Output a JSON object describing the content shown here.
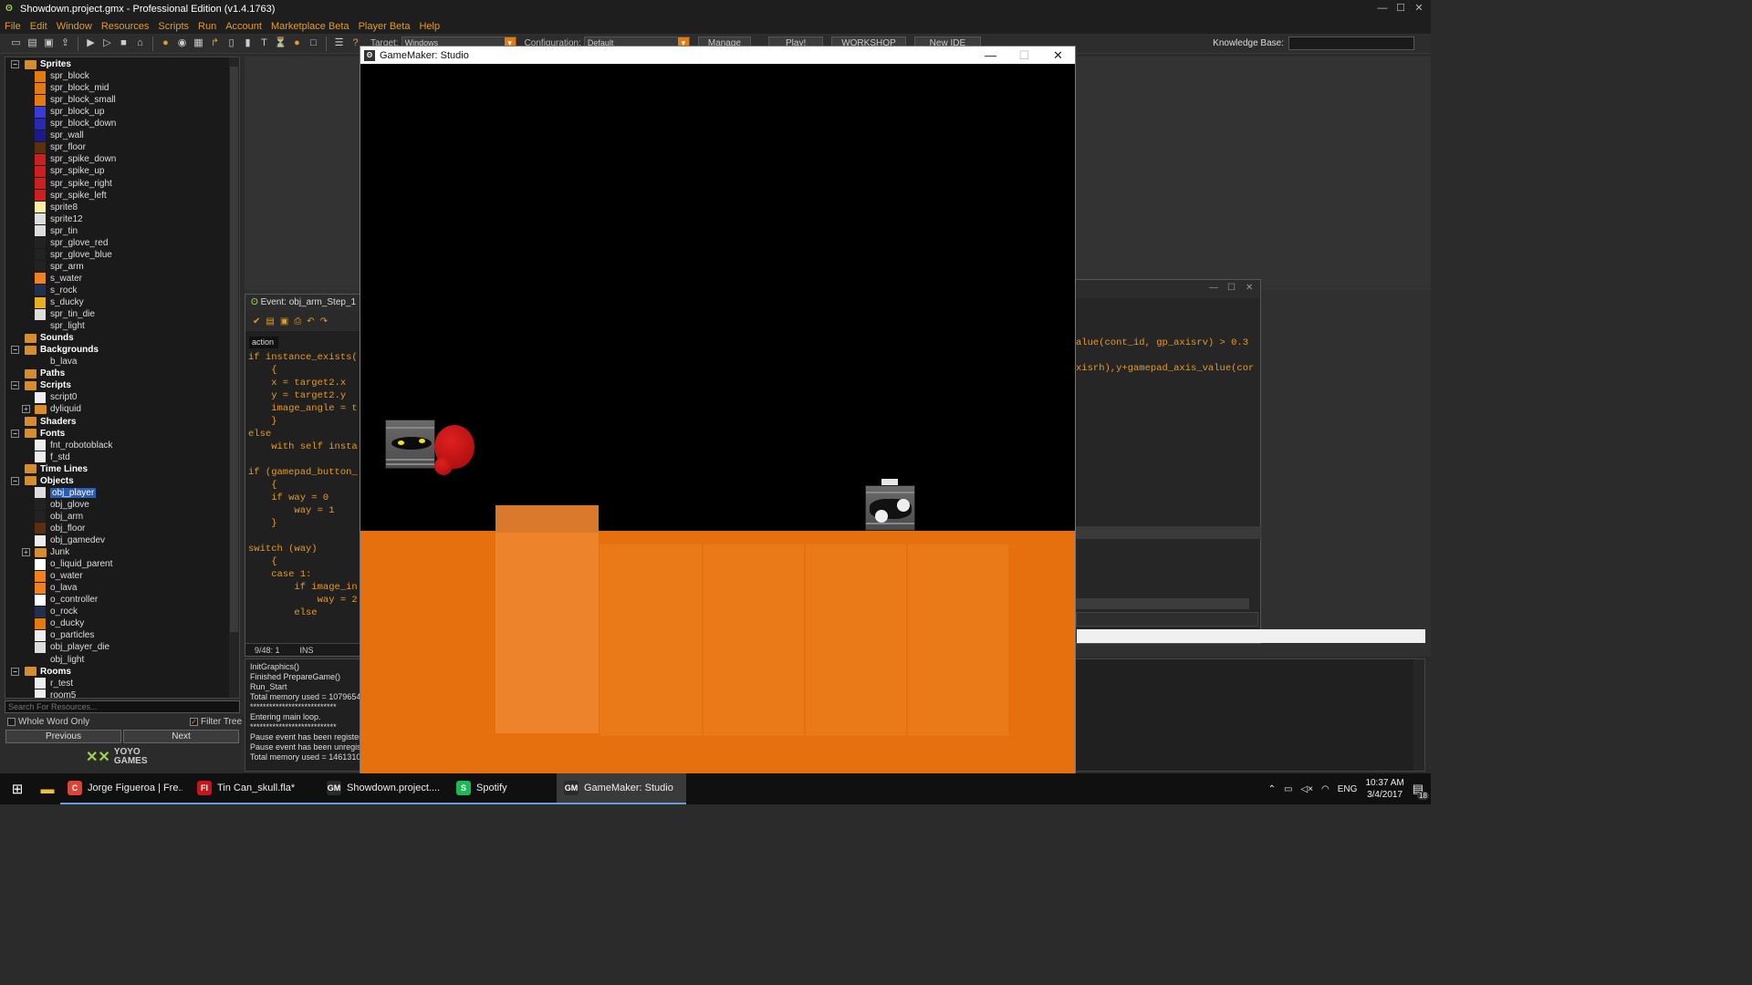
{
  "window": {
    "title": "Showdown.project.gmx  -  Professional Edition (v1.4.1763)"
  },
  "menu": [
    "File",
    "Edit",
    "Window",
    "Resources",
    "Scripts",
    "Run",
    "Account",
    "Marketplace Beta",
    "Player Beta",
    "Help"
  ],
  "toolbar": {
    "target_label": "Target:",
    "target_value": "Windows",
    "config_label": "Configuration:",
    "config_value": "Default",
    "manage": "Manage",
    "play": "Play!",
    "workshop": "WORKSHOP",
    "new_ide": "New IDE",
    "kb_label": "Knowledge Base:"
  },
  "tree": {
    "sprites_label": "Sprites",
    "sprites": [
      "spr_block",
      "spr_block_mid",
      "spr_block_small",
      "spr_block_up",
      "spr_block_down",
      "spr_wall",
      "spr_floor",
      "spr_spike_down",
      "spr_spike_up",
      "spr_spike_right",
      "spr_spike_left",
      "sprite8",
      "sprite12",
      "spr_tin",
      "spr_glove_red",
      "spr_glove_blue",
      "spr_arm",
      "s_water",
      "s_rock",
      "s_ducky",
      "spr_tin_die",
      "spr_light"
    ],
    "sounds": "Sounds",
    "backgrounds": "Backgrounds",
    "bg_items": [
      "b_lava"
    ],
    "paths": "Paths",
    "scripts": "Scripts",
    "script_items": [
      "script0",
      "dyliquid"
    ],
    "shaders": "Shaders",
    "fonts": "Fonts",
    "font_items": [
      "fnt_robotoblack",
      "f_std"
    ],
    "timelines": "Time Lines",
    "objects": "Objects",
    "object_items": [
      "obj_player",
      "obj_glove",
      "obj_arm",
      "obj_floor",
      "obj_gamedev",
      "Junk",
      "o_liquid_parent",
      "o_water",
      "o_lava",
      "o_controller",
      "o_rock",
      "o_ducky",
      "o_particles",
      "obj_player_die",
      "obj_light"
    ],
    "rooms": "Rooms",
    "room_items": [
      "r_test",
      "room5"
    ]
  },
  "search": {
    "placeholder": "Search For Resources...",
    "whole_word": "Whole Word Only",
    "filter_tree": "Filter Tree",
    "previous": "Previous",
    "next": "Next"
  },
  "brand": {
    "logo": "YOYO",
    "sub": "GAMES"
  },
  "event_editor": {
    "title": "Event: obj_arm_Step_1",
    "tab": "action",
    "code": "if instance_exists(\n    {\n    x = target2.x\n    y = target2.y\n    image_angle = t\n    }\nelse\n    with self insta\n\nif (gamepad_button_\n    {\n    if way = 0\n        way = 1\n    }\n\nswitch (way)\n    {\n    case 1:\n        if image_in\n            way = 2\n        else",
    "status_pos": "9/48:  1",
    "status_mode": "INS"
  },
  "right_editor": {
    "code": "alue(cont_id, gp_axisrv) > 0.3\n\nxisrh),y+gamepad_axis_value(cor"
  },
  "output": {
    "text": "InitGraphics()\nFinished PrepareGame()\nRun_Start\nTotal memory used = 1079654\n***************************\nEntering main loop.\n***************************\nPause event has been register\nPause event has been unregist\nTotal memory used = 1461310"
  },
  "game_window": {
    "title": "GameMaker: Studio"
  },
  "taskbar": {
    "items": [
      {
        "label": "Jorge Figueroa | Fre...",
        "color": "#db4437",
        "glyph": "C"
      },
      {
        "label": "Tin Can_skull.fla*",
        "color": "#c4161c",
        "glyph": "Fl"
      },
      {
        "label": "Showdown.project....",
        "color": "#2a2a2a",
        "glyph": "GM"
      },
      {
        "label": "Spotify",
        "color": "#1db954",
        "glyph": "S"
      },
      {
        "label": "GameMaker: Studio",
        "color": "#2a2a2a",
        "glyph": "GM"
      }
    ],
    "lang": "ENG",
    "time": "10:37 AM",
    "date": "3/4/2017",
    "notif": "18"
  }
}
